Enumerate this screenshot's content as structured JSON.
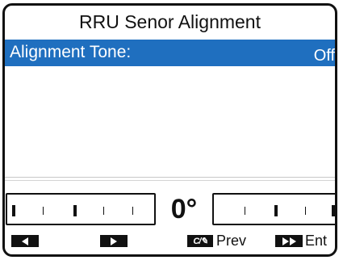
{
  "screen": {
    "title": "RRU Senor Alignment",
    "selected_row": {
      "label": "Alignment Tone:",
      "value": "Off"
    },
    "angle_readout": "0°"
  },
  "softkeys": {
    "left_icon": "left-arrow-icon",
    "right_icon": "right-arrow-icon",
    "prev_icon": "clear-edit-icon",
    "prev_label": "Prev",
    "ent_icon": "double-arrow-icon",
    "ent_label": "Ent"
  },
  "colors": {
    "highlight": "#1f6fbf",
    "foreground": "#111111",
    "background": "#ffffff"
  }
}
